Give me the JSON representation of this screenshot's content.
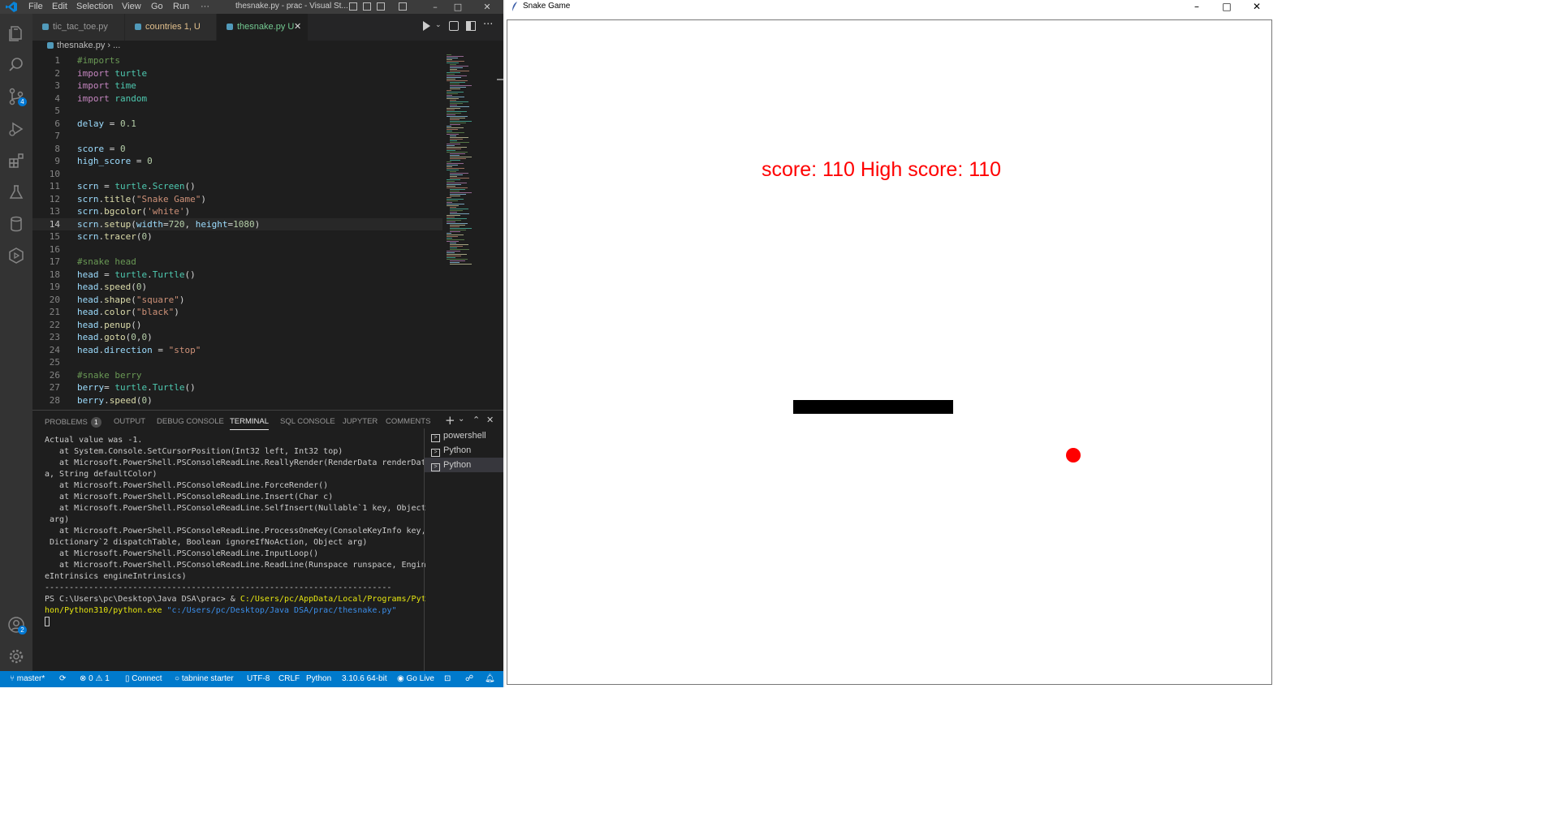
{
  "vscode": {
    "menu": [
      "File",
      "Edit",
      "Selection",
      "View",
      "Go",
      "Run",
      "···"
    ],
    "window_title": "thesnake.py - prac - Visual St...",
    "tabs": [
      {
        "label": "tic_tac_toe.py",
        "status": ""
      },
      {
        "label": "countries",
        "status": "1, U"
      },
      {
        "label": "thesnake.py",
        "status": "U"
      }
    ],
    "breadcrumb": [
      "thesnake.py",
      "..."
    ],
    "code_lines": [
      {
        "n": "1",
        "html": "<span class='cm'>#imports</span>"
      },
      {
        "n": "2",
        "html": "<span class='kw'>import</span> <span class='cl'>turtle</span>"
      },
      {
        "n": "3",
        "html": "<span class='kw'>import</span> <span class='cl'>time</span>"
      },
      {
        "n": "4",
        "html": "<span class='kw'>import</span> <span class='cl'>random</span>"
      },
      {
        "n": "5",
        "html": ""
      },
      {
        "n": "6",
        "html": "<span class='vr'>delay</span> = <span class='nm'>0.1</span>"
      },
      {
        "n": "7",
        "html": ""
      },
      {
        "n": "8",
        "html": "<span class='vr'>score</span> = <span class='nm'>0</span>"
      },
      {
        "n": "9",
        "html": "<span class='vr'>high_score</span> = <span class='nm'>0</span>"
      },
      {
        "n": "10",
        "html": ""
      },
      {
        "n": "11",
        "html": "<span class='vr'>scrn</span> = <span class='cl'>turtle</span>.<span class='cl'>Screen</span>()"
      },
      {
        "n": "12",
        "html": "<span class='vr'>scrn</span>.<span class='fn'>title</span>(<span class='st'>\"Snake Game\"</span>)"
      },
      {
        "n": "13",
        "html": "<span class='vr'>scrn</span>.<span class='fn'>bgcolor</span>(<span class='st'>'white'</span>)"
      },
      {
        "n": "14",
        "html": "<span class='vr'>scrn</span>.<span class='fn'>setup</span>(<span class='vr'>width</span>=<span class='nm'>720</span>, <span class='vr'>height</span>=<span class='nm'>1080</span>)"
      },
      {
        "n": "15",
        "html": "<span class='vr'>scrn</span>.<span class='fn'>tracer</span>(<span class='nm'>0</span>)"
      },
      {
        "n": "16",
        "html": ""
      },
      {
        "n": "17",
        "html": "<span class='cm'>#snake head</span>"
      },
      {
        "n": "18",
        "html": "<span class='vr'>head</span> = <span class='cl'>turtle</span>.<span class='cl'>Turtle</span>()"
      },
      {
        "n": "19",
        "html": "<span class='vr'>head</span>.<span class='fn'>speed</span>(<span class='nm'>0</span>)"
      },
      {
        "n": "20",
        "html": "<span class='vr'>head</span>.<span class='fn'>shape</span>(<span class='st'>\"square\"</span>)"
      },
      {
        "n": "21",
        "html": "<span class='vr'>head</span>.<span class='fn'>color</span>(<span class='st'>\"black\"</span>)"
      },
      {
        "n": "22",
        "html": "<span class='vr'>head</span>.<span class='fn'>penup</span>()"
      },
      {
        "n": "23",
        "html": "<span class='vr'>head</span>.<span class='fn'>goto</span>(<span class='nm'>0</span>,<span class='nm'>0</span>)"
      },
      {
        "n": "24",
        "html": "<span class='vr'>head</span>.<span class='vr'>direction</span> = <span class='st'>\"stop\"</span>"
      },
      {
        "n": "25",
        "html": ""
      },
      {
        "n": "26",
        "html": "<span class='cm'>#snake berry</span>"
      },
      {
        "n": "27",
        "html": "<span class='vr'>berry</span>= <span class='cl'>turtle</span>.<span class='cl'>Turtle</span>()"
      },
      {
        "n": "28",
        "html": "<span class='vr'>berry</span>.<span class='fn'>speed</span>(<span class='nm'>0</span>)"
      }
    ],
    "panel_tabs": [
      "PROBLEMS",
      "OUTPUT",
      "DEBUG CONSOLE",
      "TERMINAL",
      "SQL CONSOLE",
      "JUPYTER",
      "COMMENTS"
    ],
    "problems_count": "1",
    "terminal_lines": [
      "Actual value was -1.",
      "   at System.Console.SetCursorPosition(Int32 left, Int32 top)",
      "   at Microsoft.PowerShell.PSConsoleReadLine.ReallyRender(RenderData renderDat",
      "a, String defaultColor)",
      "   at Microsoft.PowerShell.PSConsoleReadLine.ForceRender()",
      "   at Microsoft.PowerShell.PSConsoleReadLine.Insert(Char c)",
      "   at Microsoft.PowerShell.PSConsoleReadLine.SelfInsert(Nullable`1 key, Object",
      " arg)",
      "   at Microsoft.PowerShell.PSConsoleReadLine.ProcessOneKey(ConsoleKeyInfo key,",
      " Dictionary`2 dispatchTable, Boolean ignoreIfNoAction, Object arg)",
      "   at Microsoft.PowerShell.PSConsoleReadLine.InputLoop()",
      "   at Microsoft.PowerShell.PSConsoleReadLine.ReadLine(Runspace runspace, Engin",
      "eIntrinsics engineIntrinsics)",
      "-----------------------------------------------------------------------"
    ],
    "prompt": "PS C:\\Users\\pc\\Desktop\\Java DSA\\prac> & ",
    "cmd_path_1": "C:/Users/pc/AppData/Local/Programs/Pyt",
    "cmd_path_2": "hon/Python310/python.exe",
    "cmd_arg": " \"c:/Users/pc/Desktop/Java DSA/prac/thesnake.py\"",
    "terminals": [
      "powershell",
      "Python",
      "Python"
    ],
    "status": {
      "branch": "master*",
      "errors": "0",
      "warnings": "1",
      "connect": "Connect",
      "tabnine": "tabnine starter",
      "encoding": "UTF-8",
      "eol": "CRLF",
      "language": "Python",
      "interpreter": "3.10.6 64-bit",
      "golive": "Go Live"
    },
    "source_control_badge": "4",
    "accounts_badge": "2",
    "colors": {
      "accent": "#007acc",
      "activity": "#333333",
      "editor": "#1e1e1e"
    }
  },
  "game": {
    "window_title": "Snake Game",
    "score_text": "score: 110  High score: 110",
    "score": "110",
    "high_score": "110",
    "colors": {
      "score": "#ff0000",
      "snake": "#000000",
      "berry": "#ff0000"
    }
  }
}
